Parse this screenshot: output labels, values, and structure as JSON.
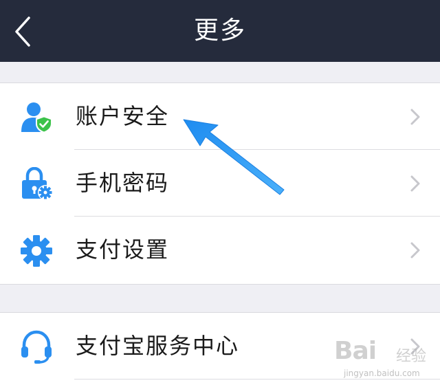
{
  "navbar": {
    "title": "更多",
    "back_icon": "chevron-left-icon",
    "background": "#252b3c"
  },
  "groups": [
    {
      "items": [
        {
          "label": "账户安全",
          "icon": "account-security-icon"
        },
        {
          "label": "手机密码",
          "icon": "phone-password-icon"
        },
        {
          "label": "支付设置",
          "icon": "payment-settings-gear-icon"
        }
      ]
    },
    {
      "items": [
        {
          "label": "支付宝服务中心",
          "icon": "headset-service-icon"
        }
      ]
    }
  ],
  "annotation": {
    "icon": "blue-arrow-pointer"
  },
  "watermark": {
    "logo_text": "Bai",
    "text": "经验",
    "url": "jingyan.baidu.com"
  },
  "colors": {
    "accent": "#2b8ff0",
    "shield_green": "#3cc24a",
    "chevron": "#c7c7cc",
    "arrow": "#2a9bf5"
  }
}
